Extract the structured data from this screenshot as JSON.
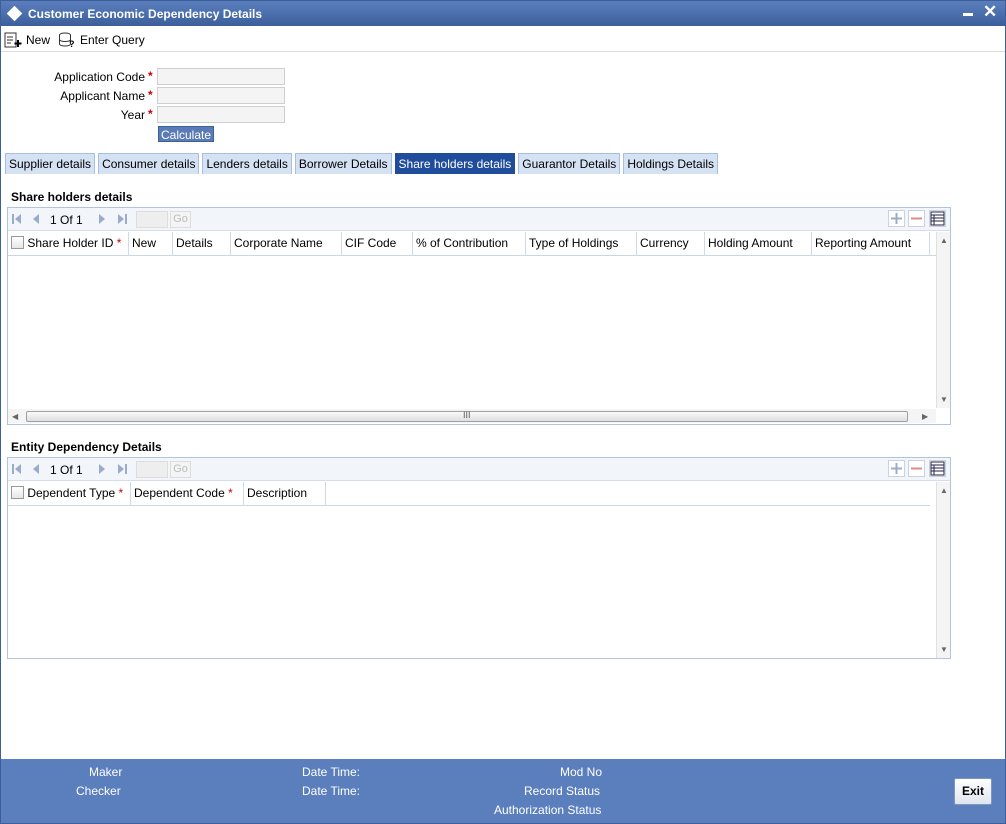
{
  "window": {
    "title": "Customer Economic Dependency Details"
  },
  "toolbar": {
    "new_label": "New",
    "enter_query_label": "Enter Query"
  },
  "form": {
    "fields": [
      {
        "label": "Application Code",
        "required": "*",
        "value": ""
      },
      {
        "label": "Applicant Name",
        "required": "*",
        "value": ""
      },
      {
        "label": "Year",
        "required": "*",
        "value": ""
      }
    ],
    "calculate_label": "Calculate"
  },
  "tabs": [
    {
      "label": "Supplier details",
      "active": false
    },
    {
      "label": "Consumer details",
      "active": false
    },
    {
      "label": "Lenders details",
      "active": false
    },
    {
      "label": "Borrower Details",
      "active": false
    },
    {
      "label": "Share holders details",
      "active": true
    },
    {
      "label": "Guarantor Details",
      "active": false
    },
    {
      "label": "Holdings Details",
      "active": false
    }
  ],
  "shareholders": {
    "title": "Share holders details",
    "page_current": "1",
    "page_of": "Of",
    "page_total": "1",
    "go_label": "Go",
    "columns": [
      {
        "label": "Share Holder ID",
        "required": "*"
      },
      {
        "label": "New"
      },
      {
        "label": "Details"
      },
      {
        "label": "Corporate Name"
      },
      {
        "label": "CIF Code"
      },
      {
        "label": "% of Contribution"
      },
      {
        "label": "Type of Holdings"
      },
      {
        "label": "Currency"
      },
      {
        "label": "Holding Amount"
      },
      {
        "label": "Reporting Amount"
      }
    ],
    "scroll_grip": "III"
  },
  "entity": {
    "title": "Entity Dependency Details",
    "page_current": "1",
    "page_of": "Of",
    "page_total": "1",
    "go_label": "Go",
    "columns": [
      {
        "label": "Dependent Type",
        "required": "*"
      },
      {
        "label": "Dependent Code",
        "required": "*"
      },
      {
        "label": "Description"
      }
    ]
  },
  "footer": {
    "maker_label": "Maker",
    "checker_label": "Checker",
    "date_time_label_1": "Date Time:",
    "date_time_label_2": "Date Time:",
    "mod_no_label": "Mod No",
    "record_status_label": "Record Status",
    "authorization_status_label": "Authorization Status",
    "exit_label": "Exit"
  },
  "colors": {
    "accent": "#5b7fbd",
    "active_tab": "#1f4d9b",
    "required": "#cc0000"
  }
}
